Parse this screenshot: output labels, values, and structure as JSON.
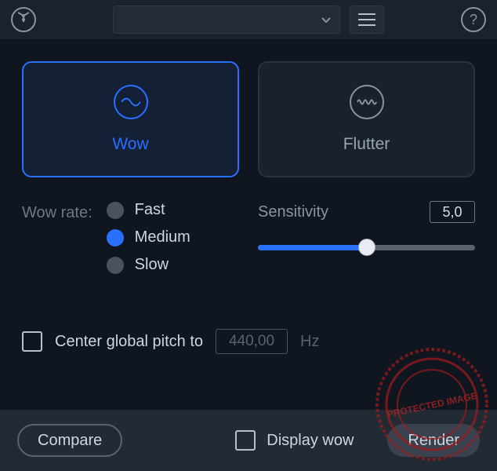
{
  "modes": {
    "wow": {
      "label": "Wow",
      "selected": true
    },
    "flutter": {
      "label": "Flutter",
      "selected": false
    }
  },
  "rate": {
    "label": "Wow rate:",
    "options": [
      "Fast",
      "Medium",
      "Slow"
    ],
    "selected": "Medium"
  },
  "sensitivity": {
    "label": "Sensitivity",
    "value": "5,0",
    "position": 0.5
  },
  "pitch": {
    "checked": false,
    "label": "Center global pitch to",
    "value": "440,00",
    "unit": "Hz"
  },
  "footer": {
    "compare": "Compare",
    "display_wow": {
      "label": "Display wow",
      "checked": false
    },
    "render": "Render"
  },
  "watermark": "PROTECTED IMAGE"
}
